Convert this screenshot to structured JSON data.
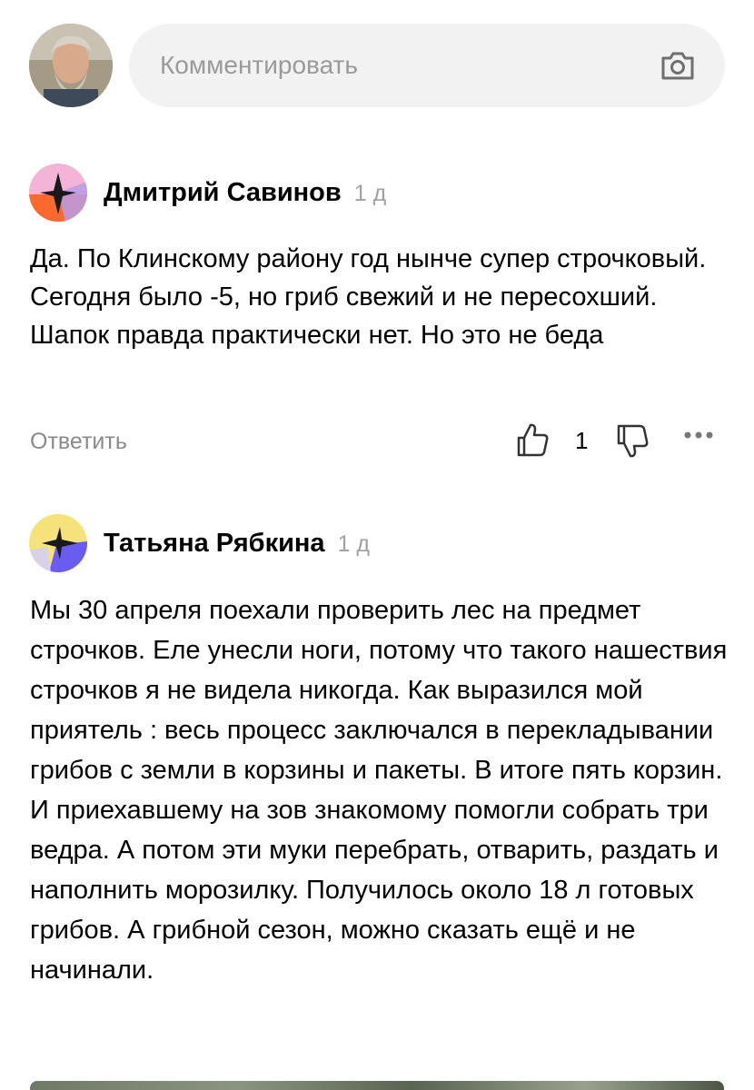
{
  "composer": {
    "placeholder": "Комментировать",
    "camera_icon": "camera-icon"
  },
  "comments": [
    {
      "author": "Дмитрий Савинов",
      "time": "1 д",
      "text": "Да. По Клинскому району год нынче супер строчковый. Сегодня было -5, но гриб свежий и не пересохший. Шапок правда практически нет. Но это не беда",
      "reply_label": "Ответить",
      "likes": "1",
      "avatar_colors": [
        "#f3b4d8",
        "#fa6a2e",
        "#b99ae8",
        "#1a1a1a"
      ]
    },
    {
      "author": "Татьяна Рябкина",
      "time": "1 д",
      "text": "Мы 30 апреля поехали проверить лес на предмет строчков. Еле унесли ноги, потому что такого нашествия строчков я не видела никогда. Как выразился мой приятель : весь процесс заключался в перекладывании грибов с земли в корзины и пакеты. В итоге пять корзин. И приехавшему на зов знакомому помогли собрать три ведра. А потом эти муки перебрать, отварить, раздать и наполнить морозилку. Получилось около 18 л готовых грибов. А грибной сезон, можно сказать ещё и не начинали.",
      "avatar_colors": [
        "#f5e27a",
        "#6a5cf0",
        "#1a1a1a"
      ]
    }
  ],
  "icons": {
    "like": "thumbs-up-icon",
    "dislike": "thumbs-down-icon",
    "more": "more-dots-icon"
  }
}
